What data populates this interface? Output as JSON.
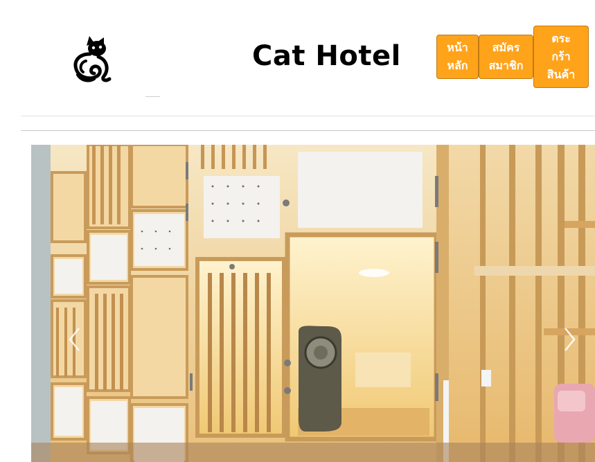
{
  "header": {
    "logo_icon": "cat-logo-icon",
    "title": "Cat Hotel"
  },
  "nav": {
    "home": "หน้า\nหลัก",
    "register": "สมัคร\nสมาชิก",
    "cart": "ตระ\nกร้า\nสินค้า"
  },
  "colors": {
    "nav_button_bg": "#ffa31a",
    "nav_button_text": "#ffffff",
    "title_text": "#000000"
  },
  "carousel": {
    "image_subject": "wooden cat hotel cages with glass doors and a pet carrier backpack",
    "prev_icon": "chevron-left-icon",
    "next_icon": "chevron-right-icon"
  }
}
